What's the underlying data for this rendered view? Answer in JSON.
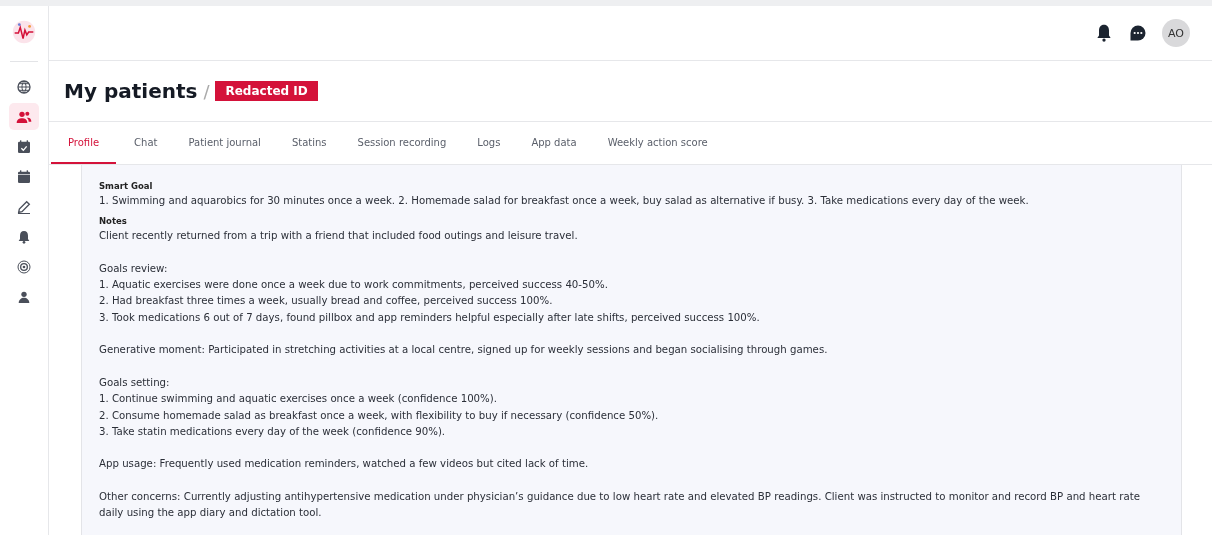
{
  "sidebar": {
    "items": [
      {
        "kind": "globe",
        "selected": false
      },
      {
        "kind": "people",
        "selected": true
      },
      {
        "kind": "task",
        "selected": false
      },
      {
        "kind": "calendar",
        "selected": false
      },
      {
        "kind": "pencil",
        "selected": false
      },
      {
        "kind": "bell",
        "selected": false
      },
      {
        "kind": "target",
        "selected": false
      },
      {
        "kind": "person",
        "selected": false
      }
    ]
  },
  "topbar": {
    "avatar": "AO"
  },
  "header": {
    "title": "My patients",
    "separator": "/",
    "badge": "Redacted ID"
  },
  "tabs": [
    {
      "label": "Profile",
      "selected": true
    },
    {
      "label": "Chat",
      "selected": false
    },
    {
      "label": "Patient journal",
      "selected": false
    },
    {
      "label": "Statins",
      "selected": false
    },
    {
      "label": "Session recording",
      "selected": false
    },
    {
      "label": "Logs",
      "selected": false
    },
    {
      "label": "App data",
      "selected": false
    },
    {
      "label": "Weekly action score",
      "selected": false
    }
  ],
  "smart_goal": {
    "label": "Smart Goal",
    "text": "1. Swimming and aquarobics for 30 minutes once a week. 2. Homemade salad for breakfast once a week, buy salad as alternative if busy. 3. Take medications every day of the week."
  },
  "notes": {
    "label": "Notes",
    "paragraphs": [
      [
        "Client recently returned from a trip with a friend that included food outings and leisure travel."
      ],
      [
        "Goals review:",
        "1. Aquatic exercises were done once a week due to work commitments, perceived success 40-50%.",
        "2. Had breakfast three times a week, usually bread and coffee, perceived success 100%.",
        "3. Took medications 6 out of 7 days, found pillbox and app reminders helpful especially after late shifts, perceived success 100%."
      ],
      [
        "Generative moment: Participated in stretching activities at a local centre, signed up for weekly sessions and began socialising through games."
      ],
      [
        "Goals setting:",
        "1. Continue swimming and aquatic exercises once a week (confidence 100%).",
        "2. Consume  homemade salad as breakfast once a week, with flexibility to buy if necessary (confidence 50%).",
        "3. Take statin medications every day of the week (confidence 90%)."
      ],
      [
        "App usage: Frequently used medication reminders, watched a few videos but cited lack of time."
      ],
      [
        "Other concerns: Currently adjusting antihypertensive medication under physician’s guidance due to low heart rate and elevated BP readings. Client was instructed to monitor and record BP and heart rate daily using the app diary and dictation tool."
      ]
    ]
  }
}
